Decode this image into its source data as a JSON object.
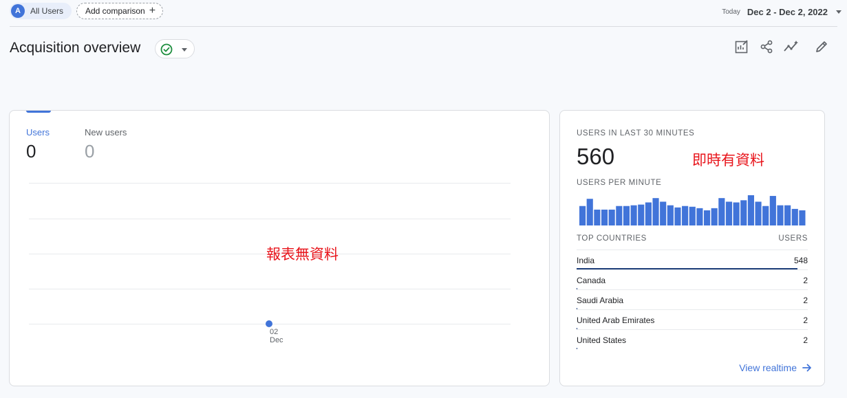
{
  "topbar": {
    "segment_initial": "A",
    "segment_label": "All Users",
    "add_comparison_label": "Add comparison",
    "date_prefix": "Today",
    "date_range": "Dec 2 - Dec 2, 2022"
  },
  "header": {
    "title": "Acquisition overview",
    "toolbar_icons": [
      "edit-report-icon",
      "share-icon",
      "insights-icon",
      "pencil-icon"
    ]
  },
  "overview_card": {
    "metrics": [
      {
        "label": "Users",
        "value": "0"
      },
      {
        "label": "New users",
        "value": "0"
      }
    ],
    "x_tick_day": "02",
    "x_tick_month": "Dec",
    "overlay_note": "報表無資料"
  },
  "realtime_card": {
    "heading": "USERS IN LAST 30 MINUTES",
    "total": "560",
    "overlay_note": "即時有資料",
    "per_minute_label": "USERS PER MINUTE",
    "per_minute_values": [
      27,
      37,
      22,
      22,
      22,
      27,
      27,
      28,
      29,
      32,
      38,
      33,
      28,
      25,
      27,
      26,
      24,
      21,
      24,
      38,
      33,
      32,
      35,
      42,
      33,
      27,
      41,
      28,
      28,
      23,
      21
    ],
    "countries_label": "TOP COUNTRIES",
    "users_label": "USERS",
    "countries": [
      {
        "name": "India",
        "users": "548",
        "share": 0.98
      },
      {
        "name": "Canada",
        "users": "2",
        "share": 0.004
      },
      {
        "name": "Saudi Arabia",
        "users": "2",
        "share": 0.004
      },
      {
        "name": "United Arab Emirates",
        "users": "2",
        "share": 0.004
      },
      {
        "name": "United States",
        "users": "2",
        "share": 0.004
      }
    ],
    "view_realtime_label": "View realtime"
  },
  "colors": {
    "accent": "#4174d9",
    "annotation_red": "#e8141b",
    "success_green": "#1e8e3e"
  }
}
